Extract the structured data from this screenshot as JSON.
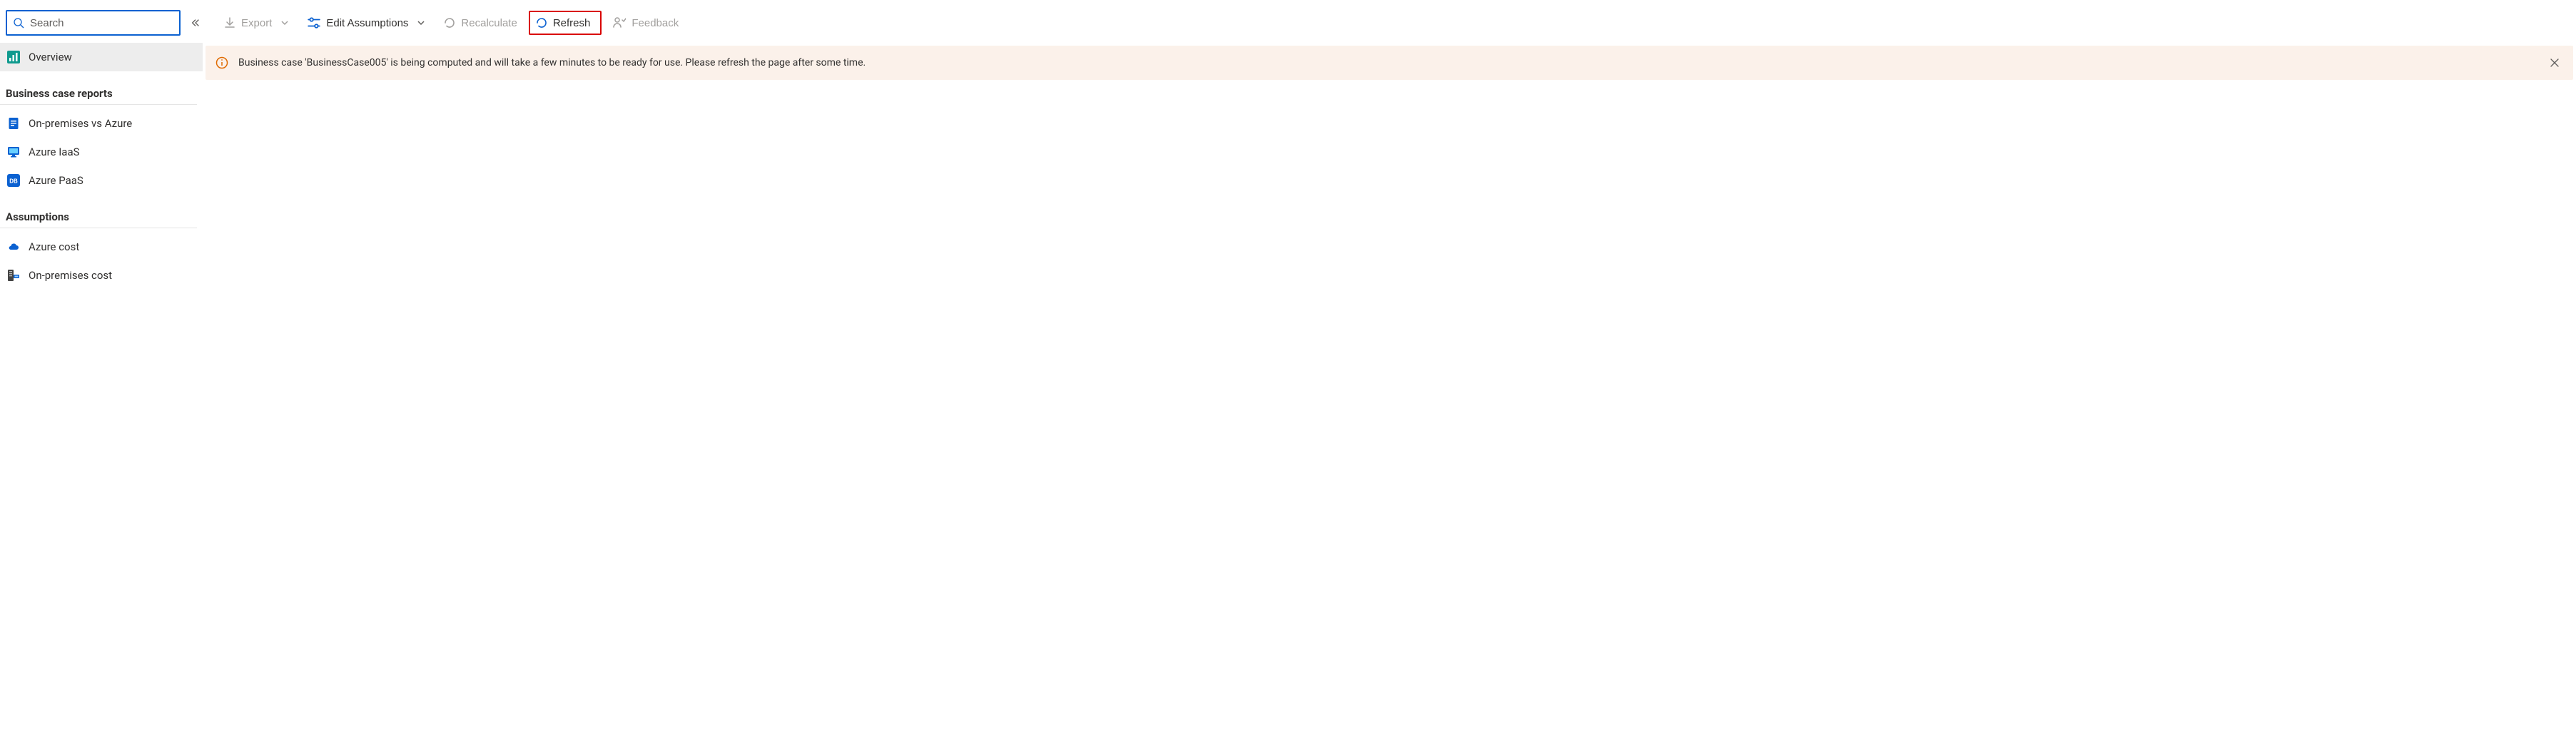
{
  "sidebar": {
    "search_placeholder": "Search",
    "overview_label": "Overview",
    "section_reports_title": "Business case reports",
    "reports": [
      {
        "label": "On-premises vs Azure"
      },
      {
        "label": "Azure IaaS"
      },
      {
        "label": "Azure PaaS"
      }
    ],
    "section_assumptions_title": "Assumptions",
    "assumptions": [
      {
        "label": "Azure cost"
      },
      {
        "label": "On-premises cost"
      }
    ]
  },
  "toolbar": {
    "export_label": "Export",
    "edit_assumptions_label": "Edit Assumptions",
    "recalculate_label": "Recalculate",
    "refresh_label": "Refresh",
    "feedback_label": "Feedback"
  },
  "message": {
    "text": "Business case 'BusinessCase005' is being computed and will take a few minutes to be ready for use. Please refresh the page after some time."
  }
}
